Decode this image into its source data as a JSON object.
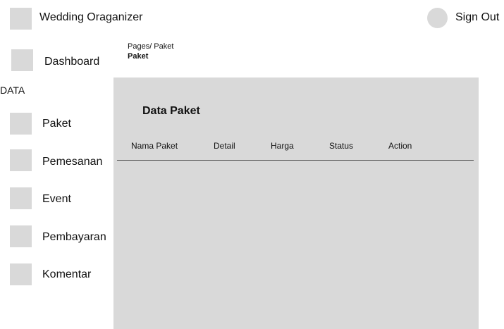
{
  "header": {
    "app_title": "Wedding Oraganizer",
    "signout_label": "Sign Out"
  },
  "sidebar": {
    "dashboard_label": "Dashboard",
    "section_label": "DATA",
    "items": [
      {
        "label": "Paket"
      },
      {
        "label": "Pemesanan"
      },
      {
        "label": "Event"
      },
      {
        "label": "Pembayaran"
      },
      {
        "label": "Komentar"
      }
    ]
  },
  "breadcrumb": {
    "path": "Pages/ Paket",
    "current": "Paket"
  },
  "main": {
    "title": "Data Paket",
    "table": {
      "columns": [
        "Nama Paket",
        "Detail",
        "Harga",
        "Status",
        "Action"
      ],
      "rows": []
    }
  },
  "colors": {
    "placeholder": "#d9d9d9",
    "text": "#111111",
    "divider": "#555555"
  }
}
